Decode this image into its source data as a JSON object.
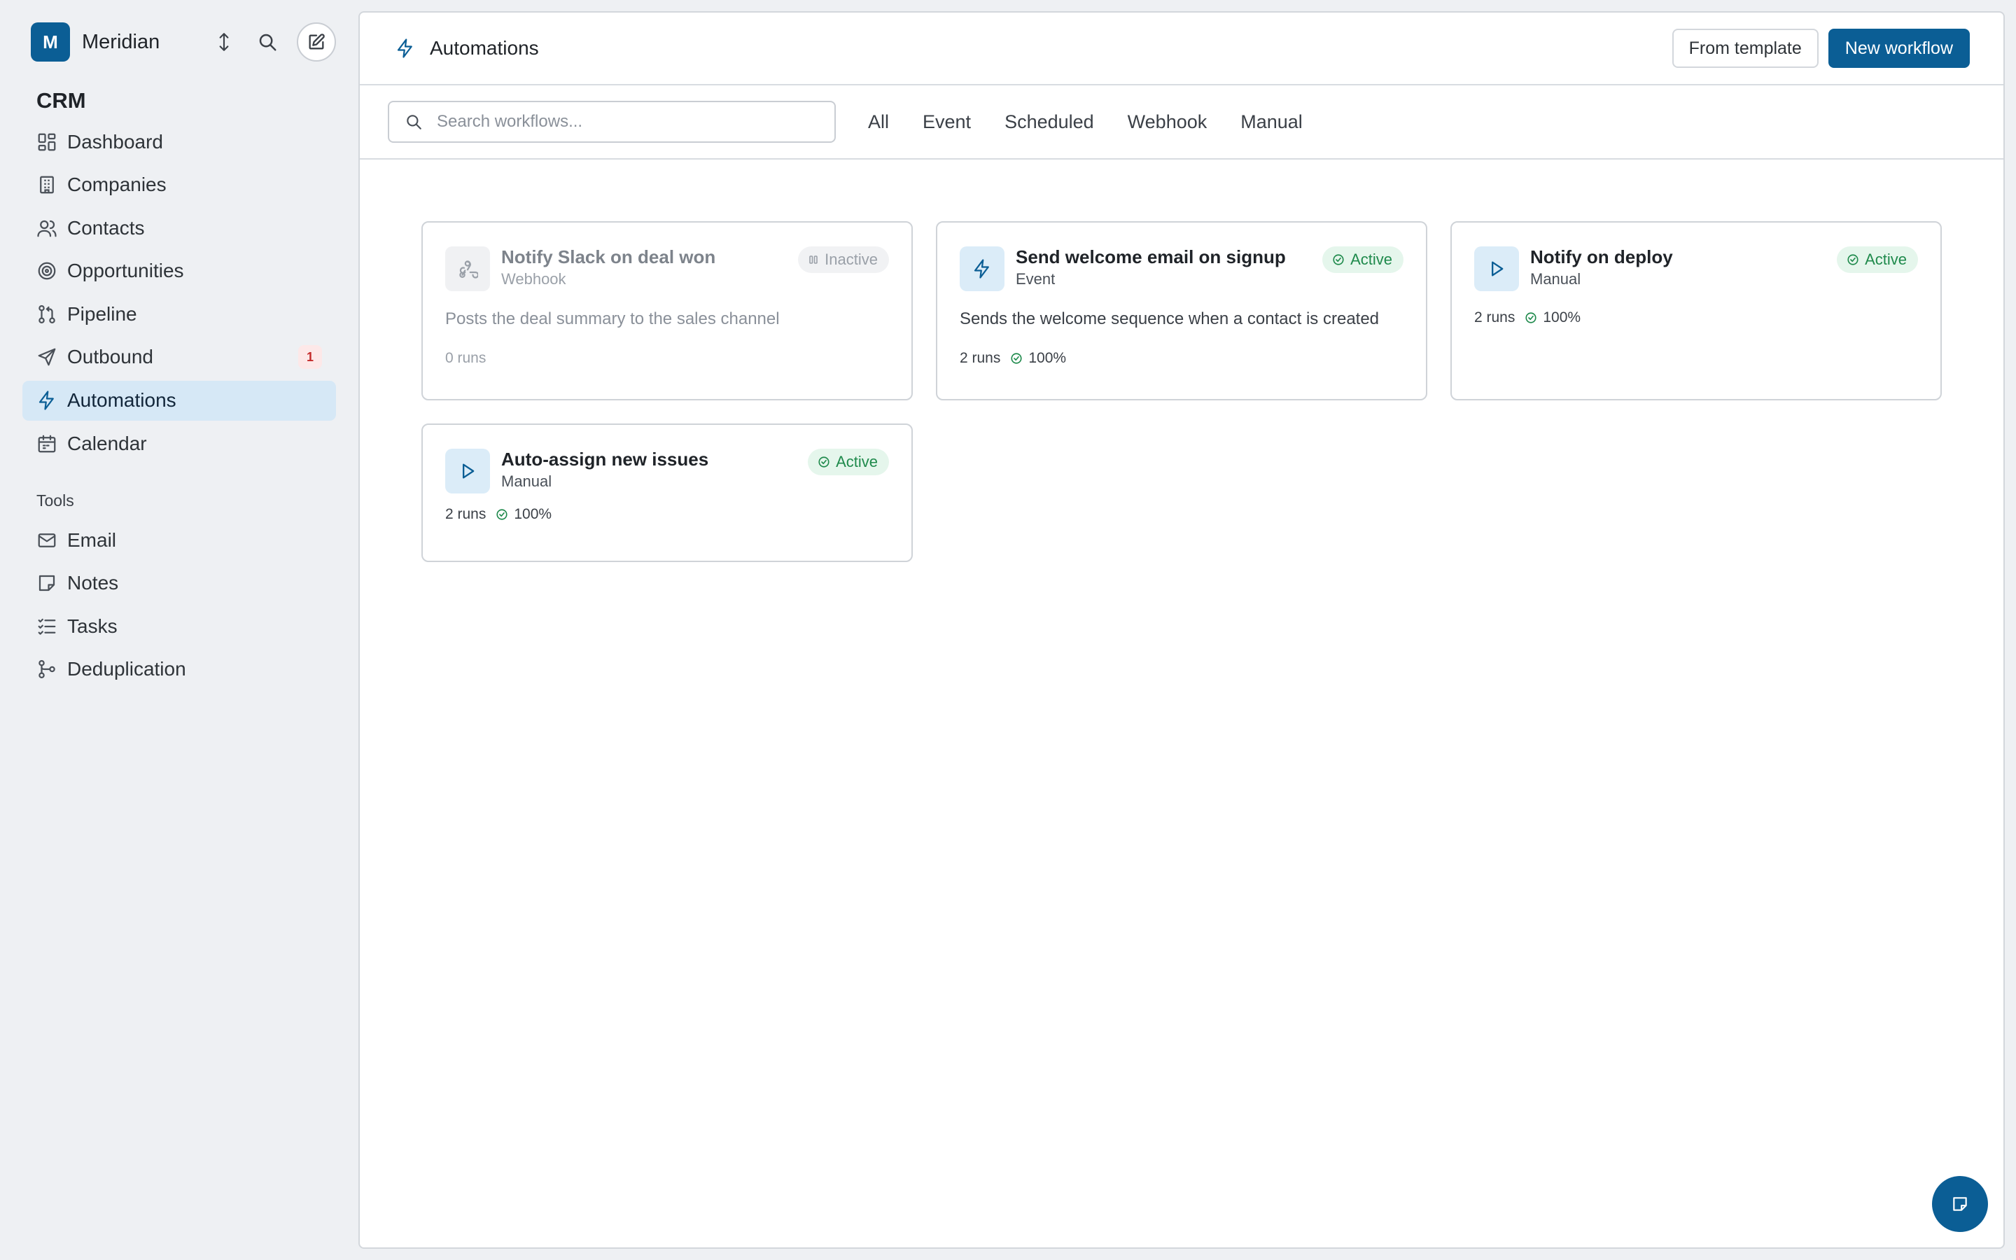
{
  "workspace": {
    "initial": "M",
    "name": "Meridian"
  },
  "sidebar": {
    "crm_title": "CRM",
    "crm_items": [
      {
        "label": "Dashboard",
        "icon": "dashboard-icon"
      },
      {
        "label": "Companies",
        "icon": "building-icon"
      },
      {
        "label": "Contacts",
        "icon": "users-icon"
      },
      {
        "label": "Opportunities",
        "icon": "target-icon"
      },
      {
        "label": "Pipeline",
        "icon": "git-pull-icon"
      },
      {
        "label": "Outbound",
        "icon": "send-icon",
        "badge": "1"
      },
      {
        "label": "Automations",
        "icon": "bolt-icon",
        "active": true
      },
      {
        "label": "Calendar",
        "icon": "calendar-icon"
      }
    ],
    "tools_title": "Tools",
    "tool_items": [
      {
        "label": "Email",
        "icon": "mail-icon"
      },
      {
        "label": "Notes",
        "icon": "note-icon"
      },
      {
        "label": "Tasks",
        "icon": "tasks-icon"
      },
      {
        "label": "Deduplication",
        "icon": "merge-icon"
      }
    ]
  },
  "header": {
    "title": "Automations",
    "from_template": "From template",
    "new_workflow": "New workflow"
  },
  "filters": {
    "search_placeholder": "Search workflows...",
    "tabs": [
      "All",
      "Event",
      "Scheduled",
      "Webhook",
      "Manual"
    ]
  },
  "workflows": [
    {
      "title": "Notify Slack on deal won",
      "type": "Webhook",
      "status": "Inactive",
      "description": "Posts the deal summary to the sales channel",
      "runs": "0 runs",
      "rate": "",
      "icon": "webhook-icon"
    },
    {
      "title": "Send welcome email on signup",
      "type": "Event",
      "status": "Active",
      "description": "Sends the welcome sequence when a contact is created",
      "runs": "2 runs",
      "rate": "100%",
      "icon": "bolt-icon"
    },
    {
      "title": "Notify on deploy",
      "type": "Manual",
      "status": "Active",
      "description": "",
      "runs": "2 runs",
      "rate": "100%",
      "icon": "play-icon"
    },
    {
      "title": "Auto-assign new issues",
      "type": "Manual",
      "status": "Active",
      "description": "",
      "runs": "2 runs",
      "rate": "100%",
      "icon": "play-icon"
    }
  ],
  "colors": {
    "accent": "#0b5e95",
    "active_bg": "#d6e8f6",
    "success": "#1f8a4c",
    "badge": "#c42b2b"
  }
}
